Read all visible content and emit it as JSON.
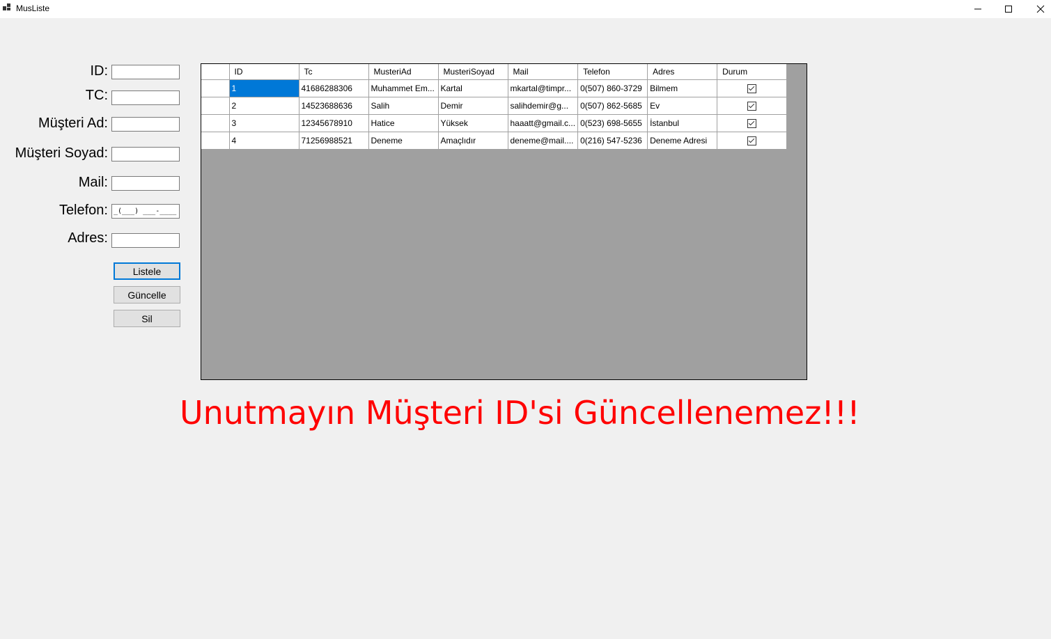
{
  "window": {
    "title": "MusListe",
    "icons": [
      "app-icon",
      "minimize-icon",
      "maximize-icon",
      "close-icon"
    ]
  },
  "form": {
    "labels": {
      "id": "ID:",
      "tc": "TC:",
      "ad": "Müşteri Ad:",
      "soyad": "Müşteri Soyad:",
      "mail": "Mail:",
      "telefon": "Telefon:",
      "adres": "Adres:"
    },
    "values": {
      "id": "",
      "tc": "",
      "ad": "",
      "soyad": "",
      "mail": "",
      "telefon": "_(___) ___-____",
      "adres": ""
    }
  },
  "buttons": {
    "listele": "Listele",
    "guncelle": "Güncelle",
    "sil": "Sil"
  },
  "grid": {
    "columns": [
      "ID",
      "Tc",
      "MusteriAd",
      "MusteriSoyad",
      "Mail",
      "Telefon",
      "Adres",
      "Durum"
    ],
    "rows": [
      [
        "1",
        "41686288306",
        "Muhammet Em...",
        "Kartal",
        "mkartal@timpr...",
        "0(507) 860-3729",
        "Bilmem",
        true
      ],
      [
        "2",
        "14523688636",
        "Salih",
        "Demir",
        "salihdemir@g...",
        "0(507) 862-5685",
        "Ev",
        true
      ],
      [
        "3",
        "12345678910",
        "Hatice",
        "Yüksek",
        "haaatt@gmail.c...",
        "0(523) 698-5655",
        "İstanbul",
        true
      ],
      [
        "4",
        "71256988521",
        "Deneme",
        "Amaçlıdır",
        "deneme@mail....",
        "0(216) 547-5236",
        "Deneme Adresi",
        true
      ]
    ],
    "selected_row": 0
  },
  "warning": "Unutmayın Müşteri ID'si Güncellenemez!!!"
}
